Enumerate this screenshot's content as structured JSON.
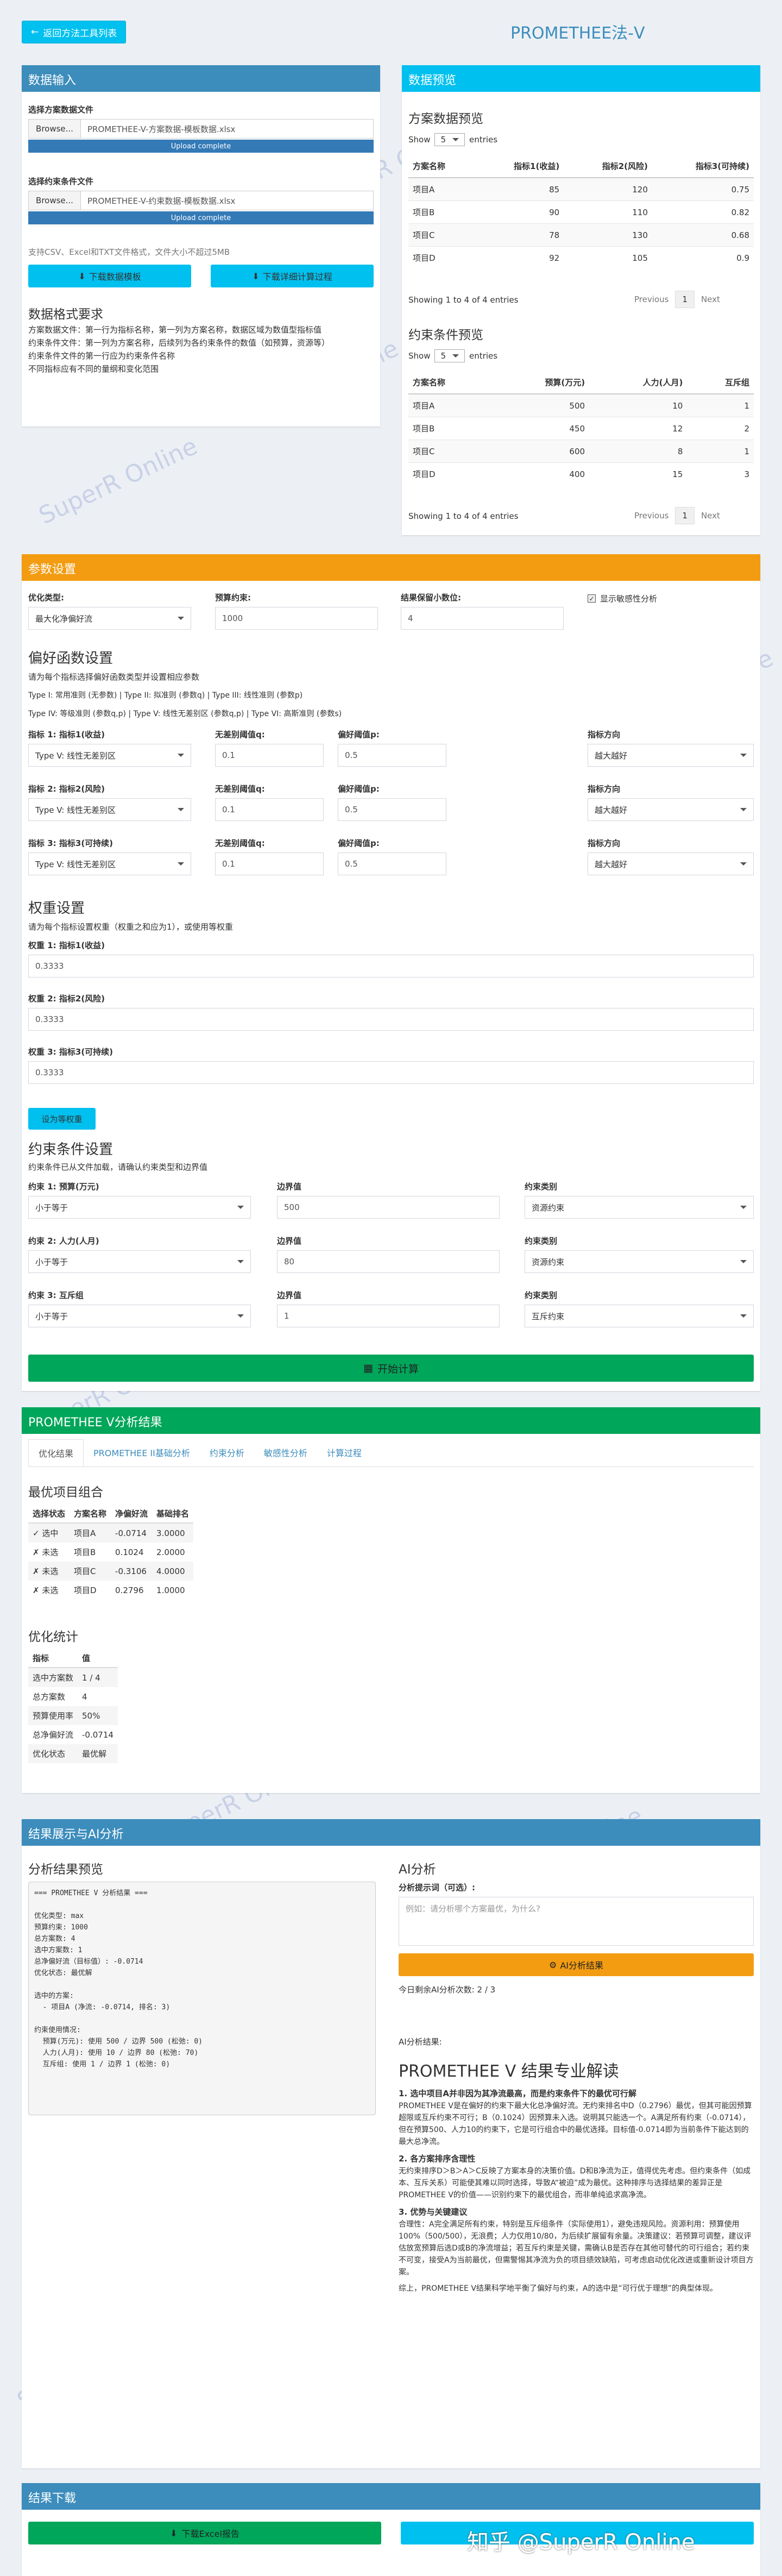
{
  "header": {
    "back_label": "返回方法工具列表",
    "title": "PROMETHEE法-V"
  },
  "data_input": {
    "title": "数据输入",
    "scheme_label": "选择方案数据文件",
    "browse": "Browse...",
    "scheme_file": "PROMETHEE-V-方案数据-模板数据.xlsx",
    "upload_complete": "Upload complete",
    "constraint_label": "选择约束条件文件",
    "constraint_file": "PROMETHEE-V-约束数据-模板数据.xlsx",
    "support_note": "支持CSV、Excel和TXT文件格式，文件大小不超过5MB",
    "download_template": "下载数据模板",
    "download_process": "下载详细计算过程",
    "format_title": "数据格式要求",
    "format_lines": [
      "方案数据文件：第一行为指标名称，第一列为方案名称，数据区域为数值型指标值",
      "约束条件文件：第一列为方案名称，后续列为各约束条件的数值（如预算，资源等）",
      "约束条件文件的第一行应为约束条件名称",
      "不同指标应有不同的量纲和变化范围"
    ]
  },
  "preview": {
    "title": "数据预览",
    "scheme_title": "方案数据预览",
    "show": "Show",
    "entries": "entries",
    "length": "5",
    "scheme_headers": [
      "方案名称",
      "指标1(收益)",
      "指标2(风险)",
      "指标3(可持续)"
    ],
    "scheme_rows": [
      [
        "项目A",
        "85",
        "120",
        "0.75"
      ],
      [
        "项目B",
        "90",
        "110",
        "0.82"
      ],
      [
        "项目C",
        "78",
        "130",
        "0.68"
      ],
      [
        "项目D",
        "92",
        "105",
        "0.9"
      ]
    ],
    "info": "Showing 1 to 4 of 4 entries",
    "previous": "Previous",
    "page": "1",
    "next": "Next",
    "constraint_title": "约束条件预览",
    "constraint_headers": [
      "方案名称",
      "预算(万元)",
      "人力(人月)",
      "互斥组"
    ],
    "constraint_rows": [
      [
        "项目A",
        "500",
        "10",
        "1"
      ],
      [
        "项目B",
        "450",
        "12",
        "2"
      ],
      [
        "项目C",
        "600",
        "8",
        "1"
      ],
      [
        "项目D",
        "400",
        "15",
        "3"
      ]
    ]
  },
  "params": {
    "title": "参数设置",
    "opt_type_label": "优化类型:",
    "opt_type": "最大化净偏好流",
    "budget_label": "预算约束:",
    "budget": "1000",
    "decimals_label": "结果保留小数位:",
    "decimals": "4",
    "sensitivity_label": "显示敏感性分析",
    "pref_title": "偏好函数设置",
    "pref_desc": "请为每个指标选择偏好函数类型并设置相应参数",
    "pref_types1": "Type I: 常用准则 (无参数) | Type II: 拟准则 (参数q) | Type III: 线性准则 (参数p)",
    "pref_types2": "Type IV: 等级准则 (参数q,p) | Type V: 线性无差别区 (参数q,p) | Type VI: 高斯准则 (参数s)",
    "criteria": [
      {
        "name": "指标 1: 指标1(收益)",
        "type": "Type V: 线性无差别区",
        "q_label": "无差别阈值q:",
        "q": "0.1",
        "p_label": "偏好阈值p:",
        "p": "0.5",
        "dir_label": "指标方向",
        "dir": "越大越好"
      },
      {
        "name": "指标 2: 指标2(风险)",
        "type": "Type V: 线性无差别区",
        "q_label": "无差别阈值q:",
        "q": "0.1",
        "p_label": "偏好阈值p:",
        "p": "0.5",
        "dir_label": "指标方向",
        "dir": "越大越好"
      },
      {
        "name": "指标 3: 指标3(可持续)",
        "type": "Type V: 线性无差别区",
        "q_label": "无差别阈值q:",
        "q": "0.1",
        "p_label": "偏好阈值p:",
        "p": "0.5",
        "dir_label": "指标方向",
        "dir": "越大越好"
      }
    ],
    "weight_title": "权重设置",
    "weight_desc": "请为每个指标设置权重（权重之和应为1），或使用等权重",
    "weights": [
      {
        "label": "权重 1: 指标1(收益)",
        "value": "0.3333"
      },
      {
        "label": "权重 2: 指标2(风险)",
        "value": "0.3333"
      },
      {
        "label": "权重 3: 指标3(可持续)",
        "value": "0.3333"
      }
    ],
    "equal_weight": "设为等权重",
    "constraint_title": "约束条件设置",
    "constraint_desc": "约束条件已从文件加载，请确认约束类型和边界值",
    "constraints": [
      {
        "name": "约束 1: 预算(万元)",
        "op": "小于等于",
        "bound_label": "边界值",
        "bound": "500",
        "cat_label": "约束类别",
        "cat": "资源约束"
      },
      {
        "name": "约束 2: 人力(人月)",
        "op": "小于等于",
        "bound_label": "边界值",
        "bound": "80",
        "cat_label": "约束类别",
        "cat": "资源约束"
      },
      {
        "name": "约束 3: 互斥组",
        "op": "小于等于",
        "bound_label": "边界值",
        "bound": "1",
        "cat_label": "约束类别",
        "cat": "互斥约束"
      }
    ],
    "run": "开始计算"
  },
  "results": {
    "title": "PROMETHEE V分析结果",
    "tabs": [
      "优化结果",
      "PROMETHEE II基础分析",
      "约束分析",
      "敏感性分析",
      "计算过程"
    ],
    "best_title": "最优项目组合",
    "best_headers": [
      "选择状态",
      "方案名称",
      "净偏好流",
      "基础排名"
    ],
    "best_rows": [
      [
        "✓ 选中",
        "项目A",
        "-0.0714",
        "3.0000"
      ],
      [
        "✗ 未选",
        "项目B",
        "0.1024",
        "2.0000"
      ],
      [
        "✗ 未选",
        "项目C",
        "-0.3106",
        "4.0000"
      ],
      [
        "✗ 未选",
        "项目D",
        "0.2796",
        "1.0000"
      ]
    ],
    "stats_title": "优化统计",
    "stats_headers": [
      "指标",
      "值"
    ],
    "stats_rows": [
      [
        "选中方案数",
        "1 / 4"
      ],
      [
        "总方案数",
        "4"
      ],
      [
        "预算使用率",
        "50%"
      ],
      [
        "总净偏好流",
        "-0.0714"
      ],
      [
        "优化状态",
        "最优解"
      ]
    ]
  },
  "ai": {
    "title": "结果展示与AI分析",
    "preview_title": "分析结果预览",
    "preview_text": "=== PROMETHEE V 分析结果 ===\n\n优化类型: max\n预算约束: 1000\n总方案数: 4\n选中方案数: 1\n总净偏好流（目标值）: -0.0714\n优化状态: 最优解\n\n选中的方案:\n  - 项目A (净流: -0.0714, 排名: 3)\n\n约束使用情况:\n  预算(万元): 使用 500 / 边界 500 (松弛: 0)\n  人力(人月): 使用 10 / 边界 80 (松弛: 70)\n  互斥组: 使用 1 / 边界 1 (松弛: 0)",
    "ai_title": "AI分析",
    "prompt_label": "分析提示词（可选）:",
    "prompt_placeholder": "例如：请分析哪个方案最优，为什么?",
    "ai_button": "AI分析结果",
    "remaining": "今日剩余AI分析次数: 2 / 3",
    "result_label": "AI分析结果:",
    "report_title": "PROMETHEE V 结果专业解读",
    "report": [
      {
        "h": "1. 选中项目A并非因为其净流最高，而是约束条件下的最优可行解",
        "p": "PROMETHEE V是在偏好的约束下最大化总净偏好流。无约束排名中D（0.2796）最优，但其可能因预算超限或互斥约束不可行；B（0.1024）因预算未入选。说明其只能选一个。A满足所有约束（-0.0714），但在预算500、人力10的约束下，它是可行组合中的最优选择。目标值-0.0714即为当前条件下能达到的最大总净流。"
      },
      {
        "h": "2. 各方案排序含理性",
        "p": "无约束排序D＞B＞A＞C反映了方案本身的决策价值。D和B净流为正，值得优先考虑。但约束条件（如成本、互斥关系）可能使其难以同时选择，导致A“被迫”成为最优。这种排序与选择结果的差异正是PROMETHEE V的价值——识别约束下的最优组合，而非单纯追求高净流。"
      },
      {
        "h": "3. 优势与关键建议",
        "p": "合理性：A完全满足所有约束，特别是互斥组条件（实际使用1），避免违规风险。资源利用：预算使用100%（500/500），无浪费；人力仅用10/80，为后续扩展留有余量。决策建议：若预算可调整，建议评估放宽预算后选D或B的净流增益；若互斥约束是关键，需确认B是否存在其他可替代的可行组合；若约束不可变，接受A为当前最优，但需警惕其净流为负的项目绩效缺陷，可考虑启动优化改进或重新设计项目方案。"
      },
      {
        "h": "",
        "p": "综上，PROMETHEE V结果科学地平衡了偏好与约束，A的选中是“可行优于理想”的典型体现。"
      }
    ]
  },
  "download": {
    "title": "结果下载",
    "excel": "下载Excel报告",
    "footer": "知乎 @SuperR Online"
  }
}
